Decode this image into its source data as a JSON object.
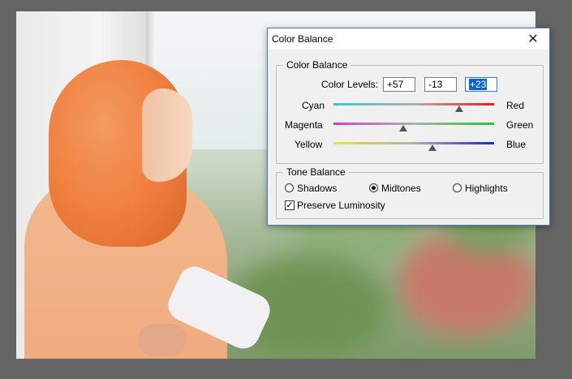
{
  "dialog": {
    "title": "Color Balance",
    "close_glyph": "✕",
    "color_balance": {
      "group_label": "Color Balance",
      "levels_label": "Color Levels:",
      "levels": [
        "+57",
        "-13",
        "+23"
      ],
      "sliders": [
        {
          "left": "Cyan",
          "right": "Red",
          "value": 57,
          "left_color": "#3ec7c7",
          "right_color": "#e02020"
        },
        {
          "left": "Magenta",
          "right": "Green",
          "value": -13,
          "left_color": "#d23cd2",
          "right_color": "#27c43a"
        },
        {
          "left": "Yellow",
          "right": "Blue",
          "value": 23,
          "left_color": "#e5e532",
          "right_color": "#1a28d6"
        }
      ],
      "slider_range": [
        -100,
        100
      ]
    },
    "tone_balance": {
      "group_label": "Tone Balance",
      "options": [
        "Shadows",
        "Midtones",
        "Highlights"
      ],
      "selected": "Midtones",
      "preserve_label": "Preserve Luminosity",
      "preserve_checked": true,
      "check_glyph": "✓"
    }
  },
  "colors": {
    "workspace": "#646464",
    "dialog_border": "#3f77c5",
    "selection": "#0a64d6"
  }
}
